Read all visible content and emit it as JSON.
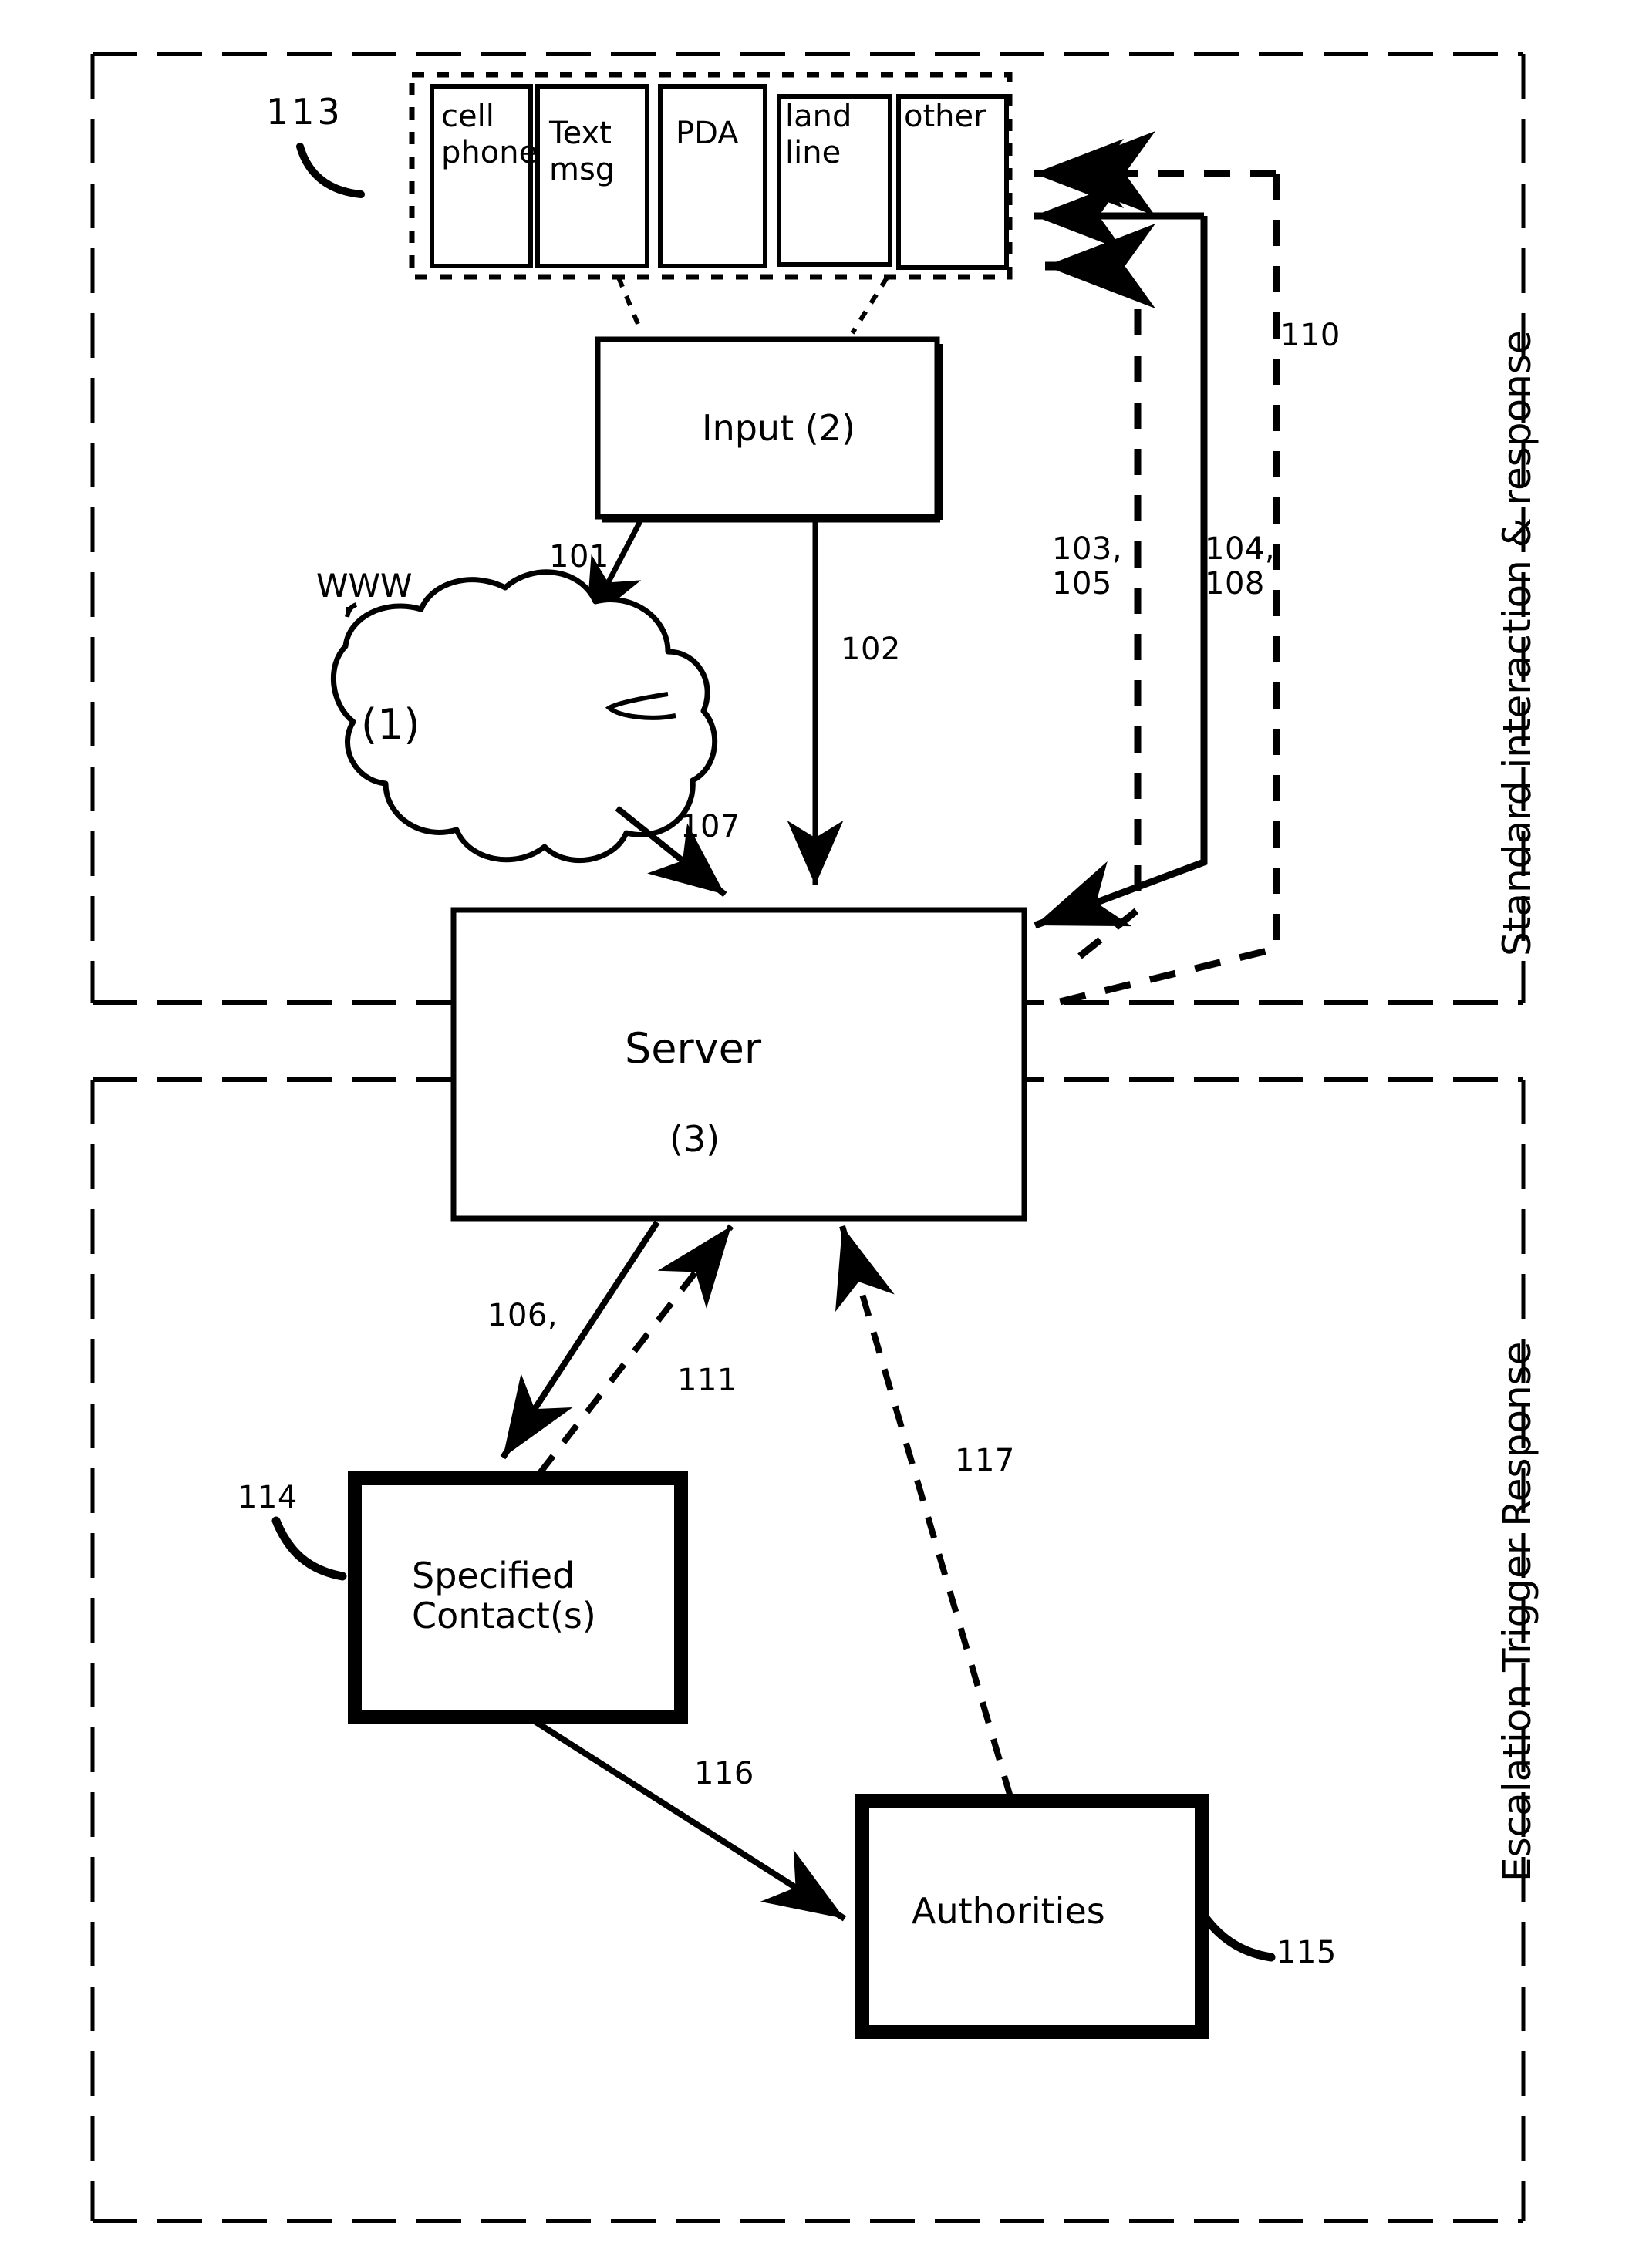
{
  "figure": {
    "type": "patent-system-flow-diagram",
    "sections": [
      {
        "id": "upper",
        "label": "Standard interaction & response"
      },
      {
        "id": "lower",
        "label": "Escalation Trigger Response"
      }
    ],
    "devices_group": {
      "ref": "113",
      "items": [
        {
          "label": "cell\nphone"
        },
        {
          "label": "Text\nmsg"
        },
        {
          "label": "PDA"
        },
        {
          "label": "land\nline"
        },
        {
          "label": "other"
        }
      ]
    },
    "nodes": {
      "input": {
        "label": "Input (2)"
      },
      "cloud": {
        "label": "(1)",
        "caption": "WWW"
      },
      "server": {
        "label": "Server",
        "sublabel": "(3)"
      },
      "contacts": {
        "label": "Specified\nContact(s)",
        "ref": "114"
      },
      "authorities": {
        "label": "Authorities",
        "ref": "115"
      }
    },
    "edge_labels": {
      "e101": "101",
      "e102": "102",
      "e107": "107",
      "e103_105": "103,\n105",
      "e104_108": "104,\n108",
      "e110": "110",
      "e106": "106,",
      "e111": "111",
      "e117": "117",
      "e116": "116"
    },
    "colors": {
      "ink": "#000000",
      "paper": "#ffffff"
    }
  }
}
